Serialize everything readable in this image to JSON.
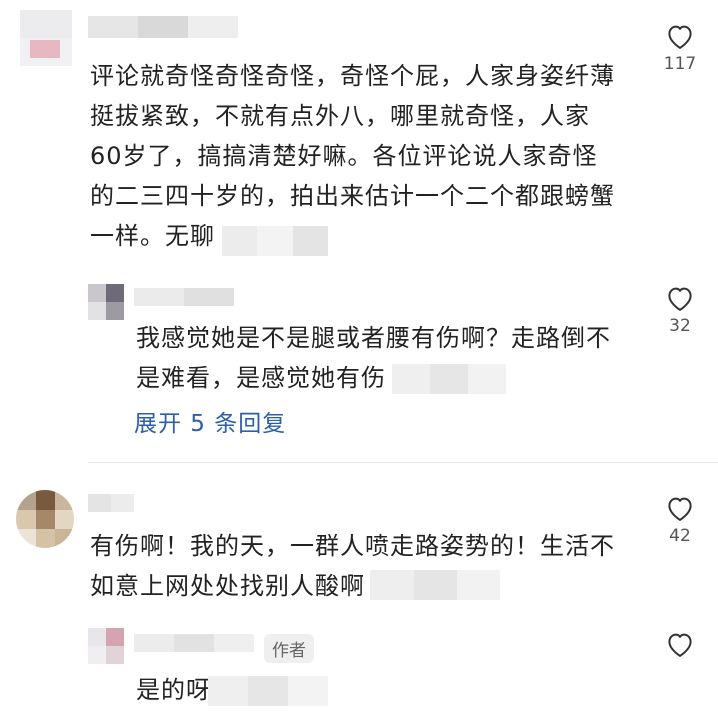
{
  "comments": [
    {
      "text_lines": [
        "评论就奇怪奇怪奇怪，奇怪个屁，人家身姿纤薄",
        "挺拔紧致，不就有点外八，哪里就奇怪，人家",
        "60岁了，搞搞清楚好嘛。各位评论说人家奇怪",
        "的二三四十岁的，拍出来估计一个二个都跟螃蟹",
        "一样。无聊"
      ],
      "likes": "117"
    },
    {
      "text_lines": [
        "我感觉她是不是腿或者腰有伤啊？走路倒不",
        "是难看，是感觉她有伤"
      ],
      "likes": "32",
      "expand_label": "展开 5 条回复"
    },
    {
      "text_lines": [
        "有伤啊！我的天，一群人喷走路姿势的！生活不",
        "如意上网处处找别人酸啊"
      ],
      "likes": "42"
    },
    {
      "author_tag": "作者",
      "text_lines": [
        "是的呀"
      ]
    }
  ],
  "icons": {
    "like": "heart-outline-icon"
  },
  "colors": {
    "link": "#2d5fa8",
    "text": "#222222",
    "count": "#555555"
  }
}
